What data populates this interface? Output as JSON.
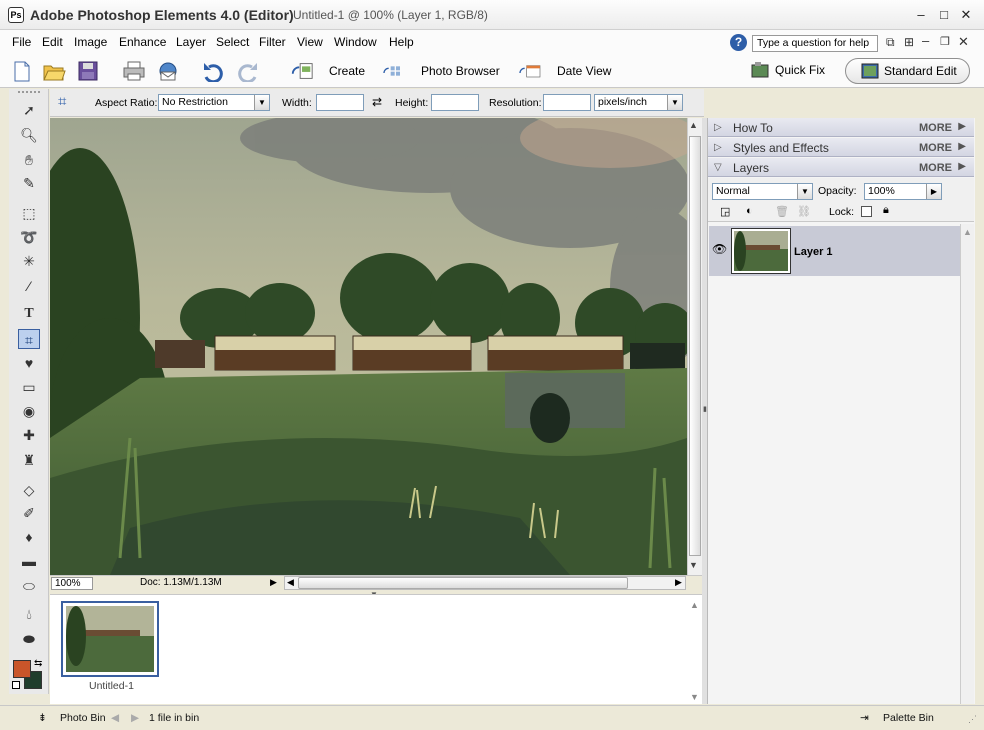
{
  "title_bar": {
    "app_title": "Adobe Photoshop Elements 4.0 (Editor)",
    "document_title": "Untitled-1 @ 100% (Layer 1, RGB/8)",
    "minimize": "–",
    "maximize": "□",
    "close": "✕"
  },
  "menu": {
    "items": [
      "File",
      "Edit",
      "Image",
      "Enhance",
      "Layer",
      "Select",
      "Filter",
      "View",
      "Window",
      "Help"
    ],
    "help_placeholder": "Type a question for help",
    "help_icon": "?"
  },
  "toolbar": {
    "create": "Create",
    "photo_browser": "Photo Browser",
    "date_view": "Date View",
    "quick_fix": "Quick Fix",
    "standard_edit": "Standard Edit"
  },
  "options": {
    "aspect_ratio_label": "Aspect Ratio:",
    "aspect_ratio_value": "No Restriction",
    "width_label": "Width:",
    "height_label": "Height:",
    "resolution_label": "Resolution:",
    "resolution_unit": "pixels/inch"
  },
  "status": {
    "zoom": "100%",
    "doc_size": "Doc: 1.13M/1.13M"
  },
  "photo_bin": {
    "thumb_label": "Untitled-1"
  },
  "palette": {
    "how_to": "How To",
    "styles_effects": "Styles and Effects",
    "layers": "Layers",
    "more": "MORE",
    "blend_mode": "Normal",
    "opacity_label": "Opacity:",
    "opacity_value": "100%",
    "lock_label": "Lock:",
    "layer_name": "Layer 1"
  },
  "bottom": {
    "photo_bin_label": "Photo Bin",
    "bin_count": "1 file in bin",
    "palette_bin_label": "Palette Bin"
  },
  "colors": {
    "foreground": "#c8552a",
    "background": "#1f3d2c",
    "accent": "#3a5fa0"
  }
}
